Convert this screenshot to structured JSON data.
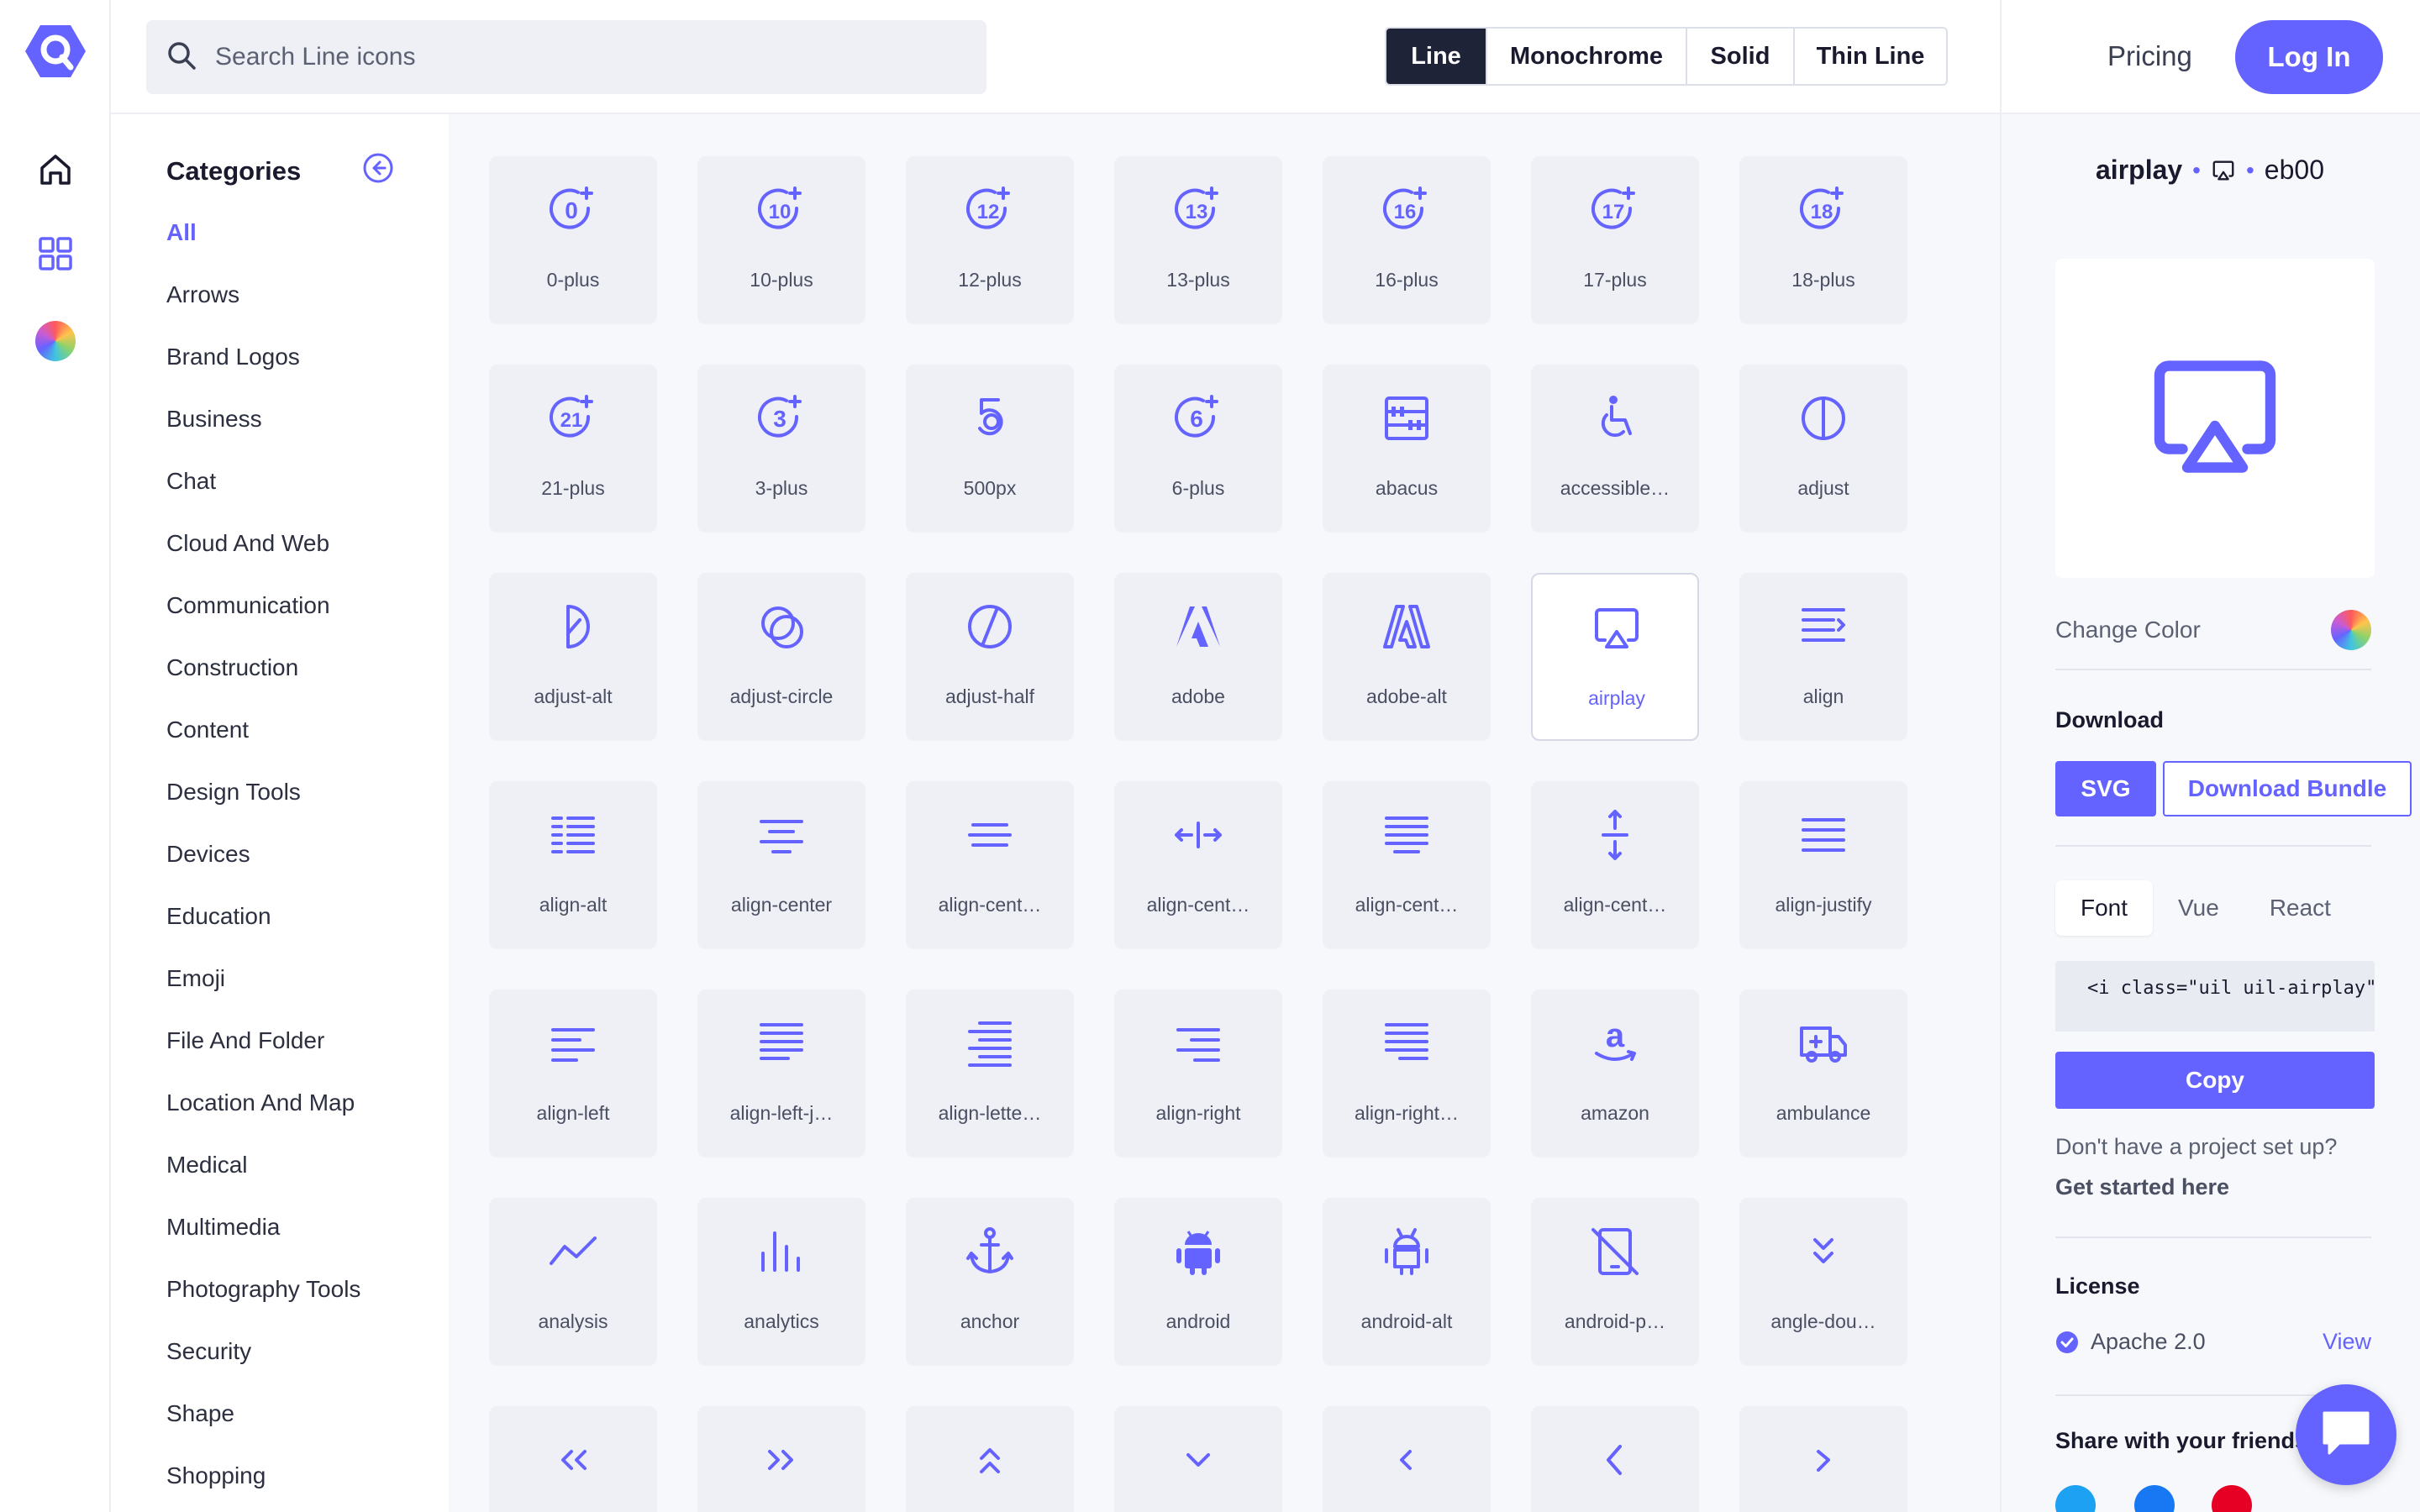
{
  "search": {
    "placeholder": "Search Line icons"
  },
  "styles": [
    {
      "label": "Line",
      "active": true
    },
    {
      "label": "Monochrome",
      "active": false
    },
    {
      "label": "Solid",
      "active": false
    },
    {
      "label": "Thin Line",
      "active": false
    }
  ],
  "header": {
    "pricing": "Pricing",
    "login": "Log In"
  },
  "categories": {
    "title": "Categories",
    "items": [
      "All",
      "Arrows",
      "Brand Logos",
      "Business",
      "Chat",
      "Cloud And Web",
      "Communication",
      "Construction",
      "Content",
      "Design Tools",
      "Devices",
      "Education",
      "Emoji",
      "File And Folder",
      "Location And Map",
      "Medical",
      "Multimedia",
      "Photography Tools",
      "Security",
      "Shape",
      "Shopping"
    ],
    "active": "All"
  },
  "icons": [
    {
      "label": "0-plus",
      "icon": "num-plus",
      "num": "0"
    },
    {
      "label": "10-plus",
      "icon": "num-plus",
      "num": "10"
    },
    {
      "label": "12-plus",
      "icon": "num-plus",
      "num": "12"
    },
    {
      "label": "13-plus",
      "icon": "num-plus",
      "num": "13"
    },
    {
      "label": "16-plus",
      "icon": "num-plus",
      "num": "16"
    },
    {
      "label": "17-plus",
      "icon": "num-plus",
      "num": "17"
    },
    {
      "label": "18-plus",
      "icon": "num-plus",
      "num": "18"
    },
    {
      "label": "21-plus",
      "icon": "num-plus",
      "num": "21"
    },
    {
      "label": "3-plus",
      "icon": "num-plus",
      "num": "3"
    },
    {
      "label": "500px",
      "icon": "500px"
    },
    {
      "label": "6-plus",
      "icon": "num-plus",
      "num": "6"
    },
    {
      "label": "abacus",
      "icon": "abacus"
    },
    {
      "label": "accessible…",
      "icon": "accessible"
    },
    {
      "label": "adjust",
      "icon": "adjust"
    },
    {
      "label": "adjust-alt",
      "icon": "adjust-alt"
    },
    {
      "label": "adjust-circle",
      "icon": "adjust-circle"
    },
    {
      "label": "adjust-half",
      "icon": "adjust-half"
    },
    {
      "label": "adobe",
      "icon": "adobe"
    },
    {
      "label": "adobe-alt",
      "icon": "adobe-alt"
    },
    {
      "label": "airplay",
      "icon": "airplay",
      "selected": true
    },
    {
      "label": "align",
      "icon": "align"
    },
    {
      "label": "align-alt",
      "icon": "align-alt"
    },
    {
      "label": "align-center",
      "icon": "align-center"
    },
    {
      "label": "align-cent…",
      "icon": "align-center-alt"
    },
    {
      "label": "align-cent…",
      "icon": "align-center-h"
    },
    {
      "label": "align-cent…",
      "icon": "align-center-justify"
    },
    {
      "label": "align-cent…",
      "icon": "align-center-v"
    },
    {
      "label": "align-justify",
      "icon": "align-justify"
    },
    {
      "label": "align-left",
      "icon": "align-left"
    },
    {
      "label": "align-left-j…",
      "icon": "align-left-justify"
    },
    {
      "label": "align-lette…",
      "icon": "align-letter"
    },
    {
      "label": "align-right",
      "icon": "align-right"
    },
    {
      "label": "align-right…",
      "icon": "align-right-justify"
    },
    {
      "label": "amazon",
      "icon": "amazon"
    },
    {
      "label": "ambulance",
      "icon": "ambulance"
    },
    {
      "label": "analysis",
      "icon": "analysis"
    },
    {
      "label": "analytics",
      "icon": "analytics"
    },
    {
      "label": "anchor",
      "icon": "anchor"
    },
    {
      "label": "android",
      "icon": "android"
    },
    {
      "label": "android-alt",
      "icon": "android-alt"
    },
    {
      "label": "android-p…",
      "icon": "android-phone"
    },
    {
      "label": "angle-dou…",
      "icon": "angle-double-down"
    },
    {
      "label": "",
      "icon": "angle-double-left"
    },
    {
      "label": "",
      "icon": "angle-double-right"
    },
    {
      "label": "",
      "icon": "angle-double-up"
    },
    {
      "label": "",
      "icon": "angle-down"
    },
    {
      "label": "",
      "icon": "angle-left"
    },
    {
      "label": "",
      "icon": "angle-left-b"
    },
    {
      "label": "",
      "icon": "angle-right"
    }
  ],
  "detail": {
    "name": "airplay",
    "icon": "airplay",
    "code": "eb00",
    "change_color": "Change Color",
    "download_title": "Download",
    "svg": "SVG",
    "bundle": "Download Bundle",
    "tabs": [
      "Font",
      "Vue",
      "React"
    ],
    "active_tab": "Font",
    "snippet": "<i class=\"uil uil-airplay\">",
    "copy": "Copy",
    "no_project": "Don't have a project set up?",
    "get_started": "Get started here",
    "license_title": "License",
    "license": "Apache 2.0",
    "view": "View",
    "share": "Share with your friends"
  },
  "colors": {
    "accent": "#6563ff",
    "dark": "#1e2338",
    "tile": "#eef0f6"
  }
}
